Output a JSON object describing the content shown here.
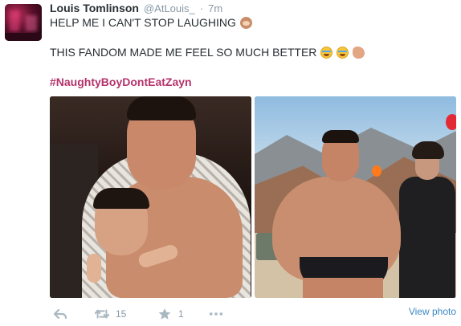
{
  "tweet": {
    "display_name": "Louis Tomlinson",
    "handle": "@AtLouis_",
    "separator": "·",
    "timestamp": "7m",
    "text_line_1": "HELP ME I CAN'T STOP LAUGHING",
    "text_line_2": "THIS FANDOM MADE ME FEEL SO MUCH BETTER",
    "hashtag": "#NaughtyBoyDontEatZayn"
  },
  "media": {
    "photos": [
      "left-photo",
      "right-photo"
    ]
  },
  "actions": {
    "retweet_count": "15",
    "favorite_count": "1",
    "view_photo_label": "View photo"
  },
  "colors": {
    "hashtag": "#b5326b",
    "muted": "#8899a6",
    "link": "#3b88c3"
  },
  "icons": [
    "reply-icon",
    "retweet-icon",
    "favorite-star-icon",
    "more-dots-icon",
    "see-no-evil-monkey-emoji",
    "tears-of-joy-emoji",
    "clapping-hands-emoji"
  ]
}
